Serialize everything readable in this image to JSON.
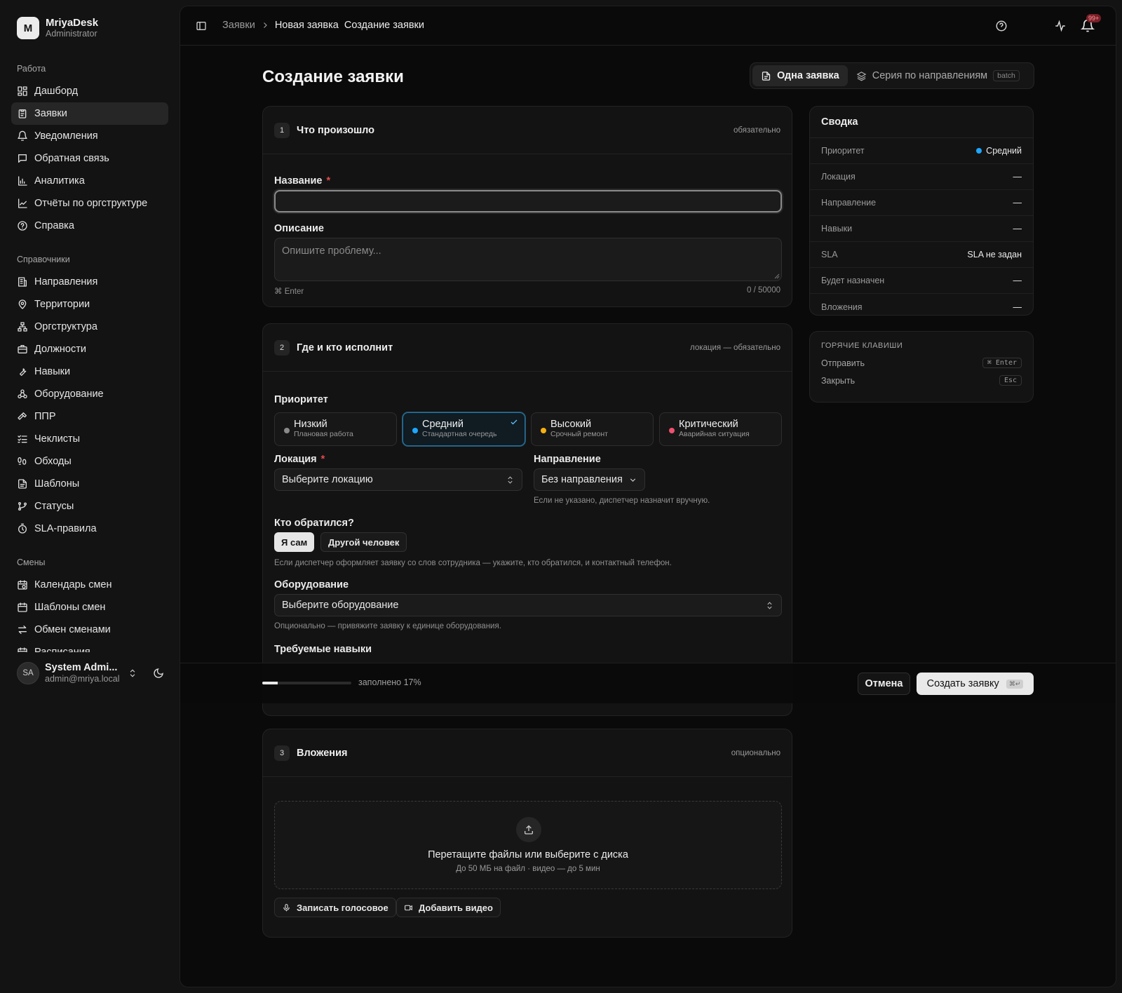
{
  "brand": {
    "logo_letter": "M",
    "name": "MriyaDesk",
    "role": "Administrator"
  },
  "nav": {
    "groups": [
      {
        "label": "Работа",
        "items": [
          {
            "label": "Дашборд",
            "icon": "dashboard-icon"
          },
          {
            "label": "Заявки",
            "icon": "clipboard-icon",
            "active": true
          },
          {
            "label": "Уведомления",
            "icon": "bell-icon"
          },
          {
            "label": "Обратная связь",
            "icon": "message-icon"
          },
          {
            "label": "Аналитика",
            "icon": "bar-chart-icon"
          },
          {
            "label": "Отчёты по оргструктуре",
            "icon": "line-chart-icon"
          },
          {
            "label": "Справка",
            "icon": "help-icon"
          }
        ]
      },
      {
        "label": "Справочники",
        "items": [
          {
            "label": "Направления",
            "icon": "building-icon"
          },
          {
            "label": "Территории",
            "icon": "map-pin-icon"
          },
          {
            "label": "Оргструктура",
            "icon": "org-icon"
          },
          {
            "label": "Должности",
            "icon": "briefcase-icon"
          },
          {
            "label": "Навыки",
            "icon": "wrench-icon"
          },
          {
            "label": "Оборудование",
            "icon": "equipment-icon"
          },
          {
            "label": "ППР",
            "icon": "hammer-icon"
          },
          {
            "label": "Чеклисты",
            "icon": "checklist-icon"
          },
          {
            "label": "Обходы",
            "icon": "footprints-icon"
          },
          {
            "label": "Шаблоны",
            "icon": "template-icon"
          },
          {
            "label": "Статусы",
            "icon": "git-branch-icon"
          },
          {
            "label": "SLA-правила",
            "icon": "timer-icon"
          }
        ]
      },
      {
        "label": "Смены",
        "items": [
          {
            "label": "Календарь смен",
            "icon": "calendar-clock-icon"
          },
          {
            "label": "Шаблоны смен",
            "icon": "calendar-icon"
          },
          {
            "label": "Обмен сменами",
            "icon": "swap-icon"
          },
          {
            "label": "Расписания",
            "icon": "calendar-icon"
          }
        ]
      }
    ]
  },
  "user": {
    "initials": "SA",
    "name": "System Admi...",
    "email": "admin@mriya.local"
  },
  "breadcrumb": {
    "root": "Заявки",
    "parent": "Новая заявка",
    "current": "Создание заявки"
  },
  "topbar": {
    "notifications_badge": "99+"
  },
  "page": {
    "title": "Создание заявки"
  },
  "mode_tabs": {
    "single": "Одна заявка",
    "series": "Серия по направлениям",
    "series_badge": "batch"
  },
  "section1": {
    "step": "1",
    "title": "Что произошло",
    "hint": "обязательно",
    "name_label": "Название",
    "name_value": "",
    "desc_label": "Описание",
    "desc_placeholder": "Опишите проблему...",
    "shortcut": "⌘ Enter",
    "counter": "0 / 50000"
  },
  "section2": {
    "step": "2",
    "title": "Где и кто исполнит",
    "hint": "локация — обязательно",
    "priority_label": "Приоритет",
    "priorities": [
      {
        "name": "Низкий",
        "desc": "Плановая работа",
        "color": "#8a8a8a"
      },
      {
        "name": "Средний",
        "desc": "Стандартная очередь",
        "color": "#1ea7fd",
        "selected": true
      },
      {
        "name": "Высокий",
        "desc": "Срочный ремонт",
        "color": "#f5b014"
      },
      {
        "name": "Критический",
        "desc": "Аварийная ситуация",
        "color": "#f0506e"
      }
    ],
    "location_label": "Локация",
    "location_placeholder": "Выберите локацию",
    "direction_label": "Направление",
    "direction_value": "Без направления",
    "direction_hint": "Если не указано, диспетчер назначит вручную.",
    "requester_label": "Кто обратился?",
    "requester_self": "Я сам",
    "requester_other": "Другой человек",
    "requester_hint": "Если диспетчер оформляет заявку со слов сотрудника — укажите, кто обратился, и контактный телефон.",
    "equipment_label": "Оборудование",
    "equipment_placeholder": "Выберите оборудование",
    "equipment_hint": "Опционально — привяжите заявку к единице оборудования.",
    "skills_label": "Требуемые навыки"
  },
  "section3": {
    "step": "3",
    "title": "Вложения",
    "hint": "опционально",
    "drop_title": "Перетащите файлы или выберите с диска",
    "drop_sub": "До 50 МБ на файл · видео — до 5 мин",
    "voice_button": "Записать голосовое",
    "video_button": "Добавить видео"
  },
  "summary": {
    "title": "Сводка",
    "rows": [
      {
        "key": "Приоритет",
        "value": "Средний",
        "dot": "#1ea7fd"
      },
      {
        "key": "Локация",
        "value": "—"
      },
      {
        "key": "Направление",
        "value": "—"
      },
      {
        "key": "Навыки",
        "value": "—"
      },
      {
        "key": "SLA",
        "value": "SLA не задан"
      },
      {
        "key": "Будет назначен",
        "value": "—"
      },
      {
        "key": "Вложения",
        "value": "—"
      }
    ]
  },
  "hotkeys": {
    "title": "ГОРЯЧИЕ КЛАВИШИ",
    "rows": [
      {
        "label": "Отправить",
        "key": "⌘ Enter"
      },
      {
        "label": "Закрыть",
        "key": "Esc"
      }
    ]
  },
  "footer": {
    "progress_percent": 17,
    "progress_text": "заполнено 17%",
    "cancel": "Отмена",
    "create": "Создать заявку",
    "create_kbd": "⌘↵"
  }
}
